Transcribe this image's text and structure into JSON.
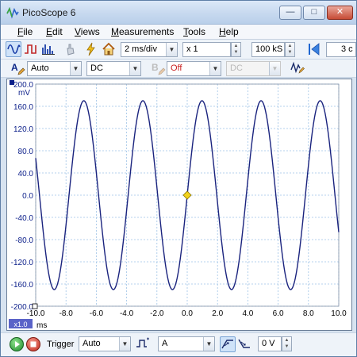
{
  "window": {
    "title": "PicoScope 6"
  },
  "caption_buttons": {
    "minimize": "—",
    "maximize": "□",
    "close": "✕"
  },
  "menu": [
    {
      "key": "F",
      "rest": "ile"
    },
    {
      "key": "E",
      "rest": "dit"
    },
    {
      "key": "V",
      "rest": "iews"
    },
    {
      "key": "M",
      "rest": "easurements"
    },
    {
      "key": "T",
      "rest": "ools"
    },
    {
      "key": "H",
      "rest": "elp"
    }
  ],
  "toolbar": {
    "timebase": "2 ms/div",
    "zoom": "x 1",
    "samples": "100 kS",
    "captures": "3 c"
  },
  "channel": {
    "label": "A",
    "range": "Auto",
    "coupling": "DC",
    "channel_b_label": "B",
    "channel_b_state": "Off",
    "channel_b_coupling": "DC"
  },
  "plot": {
    "y_unit": "mV",
    "x_unit": "ms",
    "zoom_badge": "x1.0",
    "y_ticks": [
      "200.0",
      "160.0",
      "120.0",
      "80.0",
      "40.0",
      "0.0",
      "-40.0",
      "-80.0",
      "-120.0",
      "-160.0",
      "-200.0"
    ],
    "x_ticks": [
      "-10.0",
      "-8.0",
      "-6.0",
      "-4.0",
      "-2.0",
      "0.0",
      "2.0",
      "4.0",
      "6.0",
      "8.0",
      "10.0"
    ],
    "trace_color": "#1a237e",
    "trigger_marker_color": "#f2d21b"
  },
  "trigger": {
    "label": "Trigger",
    "mode": "Auto",
    "source": "A",
    "threshold": "0 V"
  },
  "chart_data": {
    "type": "line",
    "x_label": "ms",
    "y_label": "mV",
    "xlim": [
      -10,
      10
    ],
    "ylim": [
      -200,
      200
    ],
    "grid": true,
    "series": [
      {
        "name": "A",
        "waveform": "sine",
        "amplitude_mv": 170,
        "period_ms": 3.9,
        "phase_at_zero": "rising through 0 mV at 0 ms"
      }
    ],
    "trigger_point": {
      "x": 0,
      "y": 0
    }
  },
  "colors": {
    "title_bar": "#c7d9ef",
    "grid": "#9fc3e6",
    "trace": "#1a237e"
  }
}
